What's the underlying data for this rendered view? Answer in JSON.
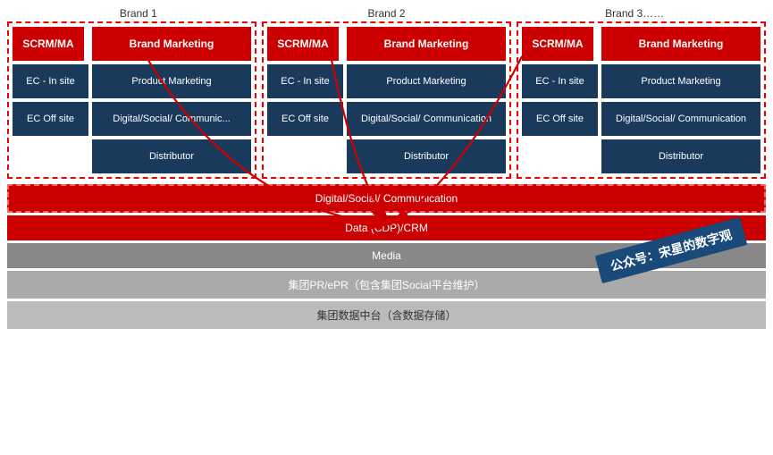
{
  "brands": [
    {
      "label": "Brand 1"
    },
    {
      "label": "Brand 2"
    },
    {
      "label": "Brand 3……"
    }
  ],
  "brand_groups": [
    {
      "scrm": "SCRM/MA",
      "brand_marketing": "Brand Marketing",
      "ec_insite": "EC - In site",
      "product_marketing": "Product Marketing",
      "ec_offsite": "EC Off site",
      "digital_social": "Digital/Social/ Communic...",
      "distributor": "Distributor"
    },
    {
      "scrm": "SCRM/MA",
      "brand_marketing": "Brand Marketing",
      "ec_insite": "EC - In site",
      "product_marketing": "Product Marketing",
      "ec_offsite": "EC Off site",
      "digital_social": "Digital/Social/ Communication",
      "distributor": "Distributor"
    },
    {
      "scrm": "SCRM/MA",
      "brand_marketing": "Brand Marketing",
      "ec_insite": "EC - In site",
      "product_marketing": "Product Marketing",
      "ec_offsite": "EC Off site",
      "digital_social": "Digital/Social/ Communication",
      "distributor": "Distributor"
    }
  ],
  "bottom_bars": [
    {
      "text": "Digital/Social/ Communication",
      "type": "red-dashed"
    },
    {
      "text": "Data (CDP)/CRM",
      "type": "red"
    },
    {
      "text": "Media",
      "type": "gray"
    },
    {
      "text": "集团PR/ePR（包含集团Social平台维护）",
      "type": "gray"
    },
    {
      "text": "集团数据中台（含数据存储）",
      "type": "gray"
    }
  ],
  "watermark": {
    "line1": "公众号：宋星的数字观",
    "line2": ""
  }
}
